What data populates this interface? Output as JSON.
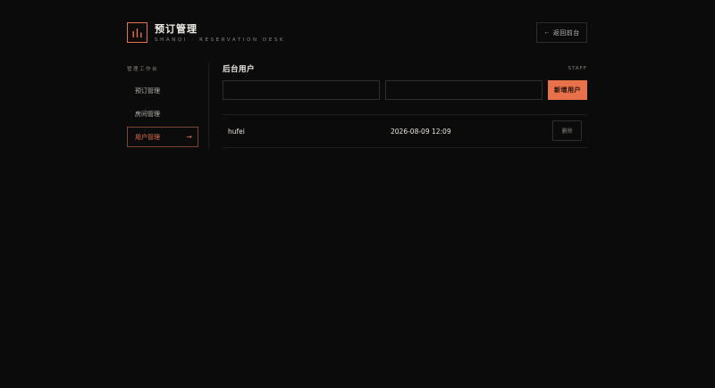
{
  "brand": {
    "title": "预订管理",
    "subtitle": "SHANQI · RESERVATION DESK",
    "logo_icon": "bars-chart-icon",
    "accent": "#e8714a"
  },
  "header": {
    "back_label": "返回前台",
    "back_icon": "arrow-left-icon"
  },
  "sidebar": {
    "section_label": "管理工作台",
    "items": [
      {
        "label": "预订管理",
        "active": false
      },
      {
        "label": "房间管理",
        "active": false
      },
      {
        "label": "用户管理",
        "active": true,
        "arrow": "→"
      }
    ]
  },
  "main": {
    "title": "后台用户",
    "tag": "STAFF",
    "form": {
      "username_value": "",
      "password_value": "",
      "add_label": "新增用户"
    },
    "users": [
      {
        "name": "hufei",
        "created": "2026-08-09 12:09",
        "delete_label": "删除"
      }
    ]
  },
  "colors": {
    "background": "#0b0b0b",
    "accent": "#e8714a",
    "border": "#2e2e2e",
    "muted_text": "#8a857e"
  }
}
